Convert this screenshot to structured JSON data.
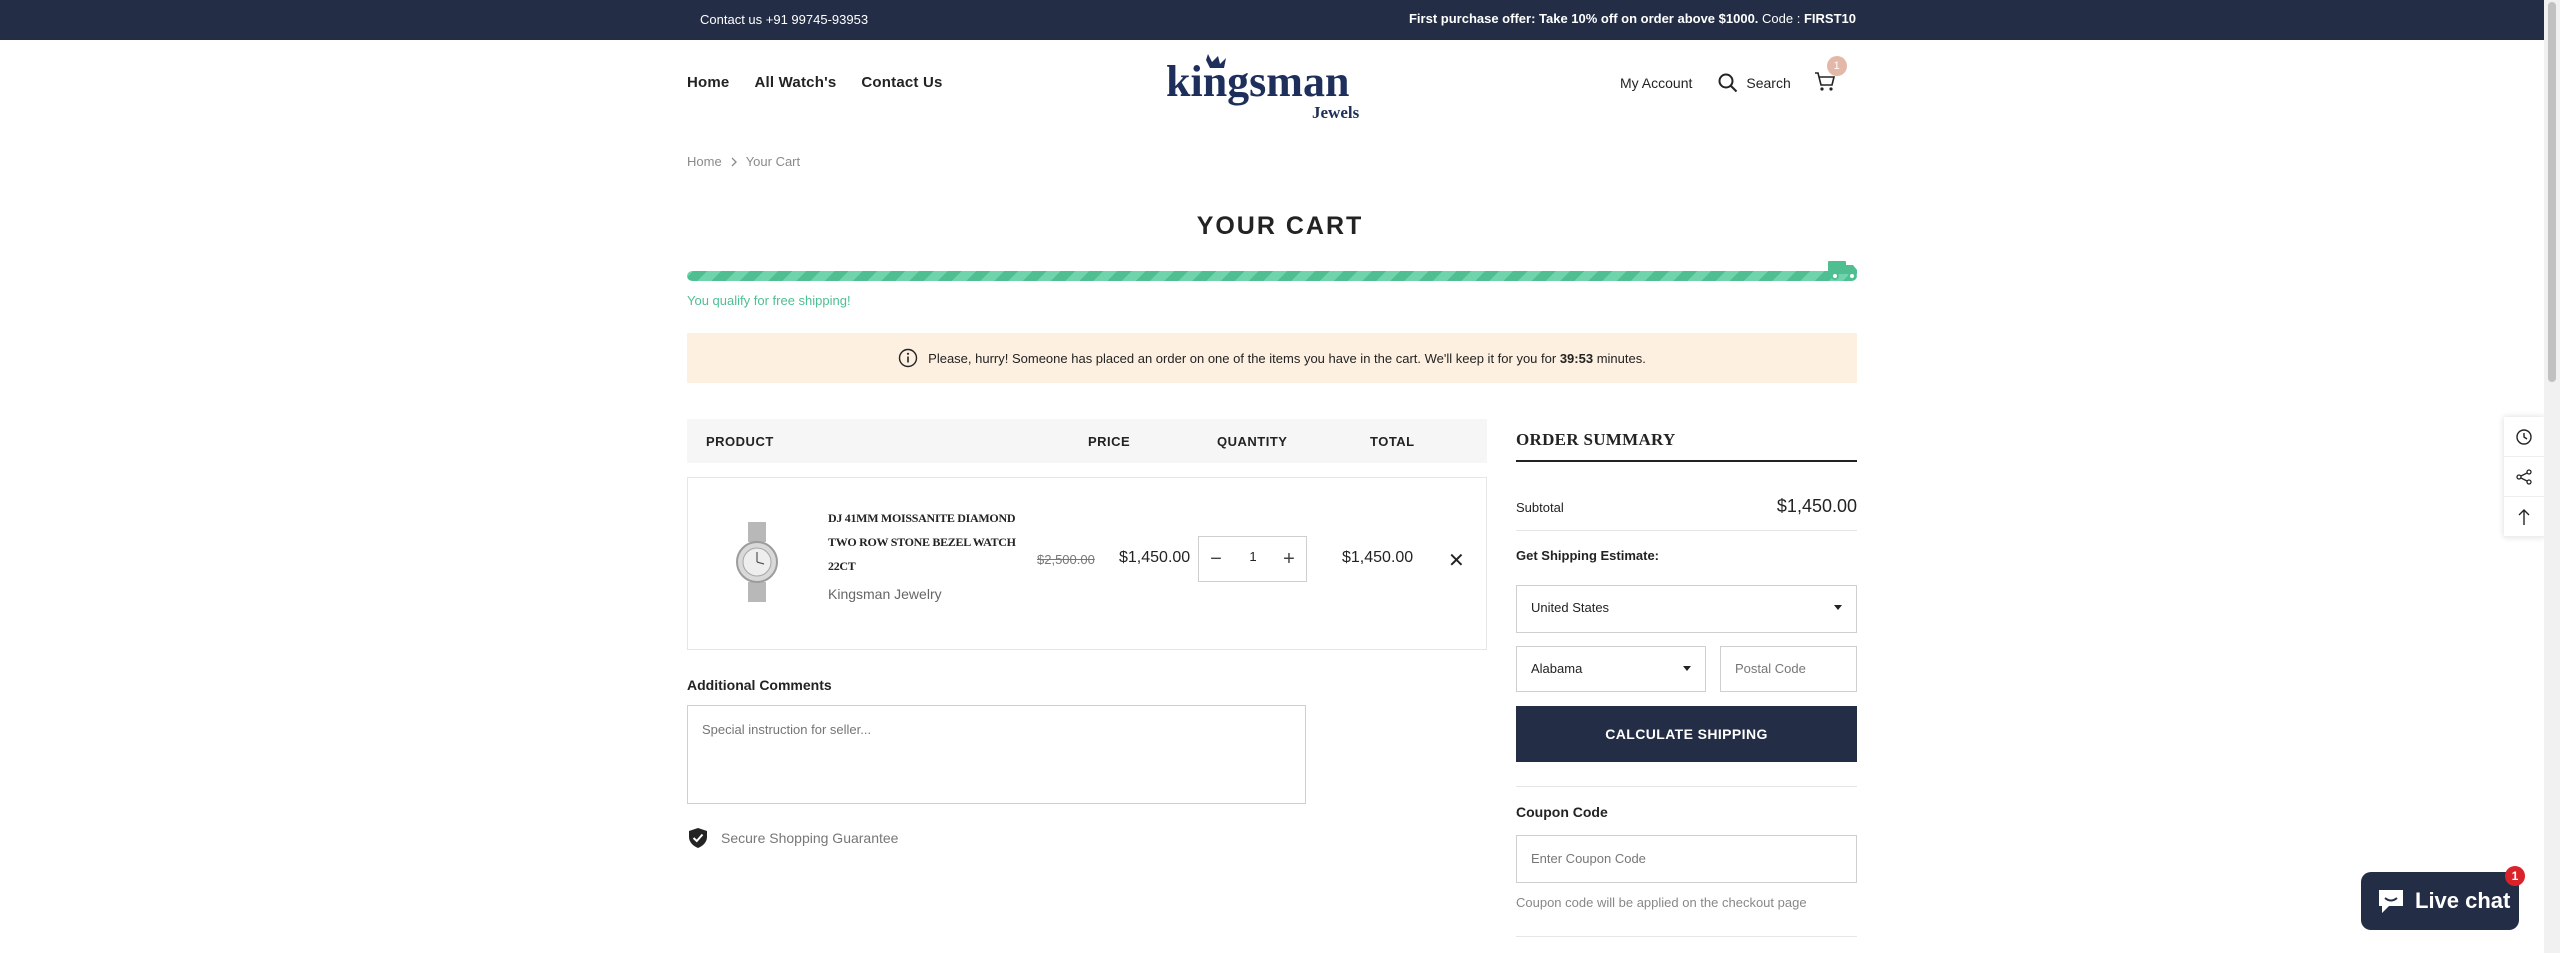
{
  "topbar": {
    "contact": "Contact us +91 99745-93953",
    "offer": "First purchase offer: Take 10% off on order above $1000.",
    "code_label": "Code :",
    "code": "FIRST10"
  },
  "nav": {
    "home": "Home",
    "all_watches": "All Watch's",
    "contact": "Contact Us"
  },
  "logo": {
    "brand": "kingsman",
    "sub": "Jewels"
  },
  "header": {
    "account": "My Account",
    "search": "Search",
    "cart_count": "1"
  },
  "breadcrumb": {
    "home": "Home",
    "current": "Your Cart"
  },
  "page": {
    "title": "YOUR CART"
  },
  "shipping_progress": {
    "percent": 100,
    "message": "You qualify for free shipping!"
  },
  "notice": {
    "text_before": "Please, hurry! Someone has placed an order on one of the items you have in the cart. We'll keep it for you for",
    "time": "39:53",
    "text_after": "minutes."
  },
  "table": {
    "headers": {
      "product": "PRODUCT",
      "price": "PRICE",
      "quantity": "QUANTITY",
      "total": "TOTAL"
    },
    "item": {
      "title": "DJ 41MM MOISSANITE DIAMOND TWO ROW STONE BEZEL WATCH 22CT",
      "vendor": "Kingsman Jewelry",
      "compare_price": "$2,500.00",
      "price": "$1,450.00",
      "quantity": "1",
      "total": "$1,450.00"
    }
  },
  "comments": {
    "label": "Additional Comments",
    "placeholder": "Special instruction for seller..."
  },
  "secure": {
    "text": "Secure Shopping Guarantee"
  },
  "summary": {
    "title": "ORDER SUMMARY",
    "subtotal_label": "Subtotal",
    "subtotal": "$1,450.00",
    "shipping_label": "Get Shipping Estimate:",
    "country": "United States",
    "state": "Alabama",
    "postal_placeholder": "Postal Code",
    "calc_button": "CALCULATE SHIPPING",
    "coupon_label": "Coupon Code",
    "coupon_placeholder": "Enter Coupon Code",
    "coupon_note": "Coupon code will be applied on the checkout page"
  },
  "chat": {
    "label": "Live chat",
    "badge": "1"
  },
  "colors": {
    "navy": "#232d45",
    "green": "#4fbf92",
    "notice_bg": "#fdf0e0",
    "chat_badge": "#d8232a"
  }
}
